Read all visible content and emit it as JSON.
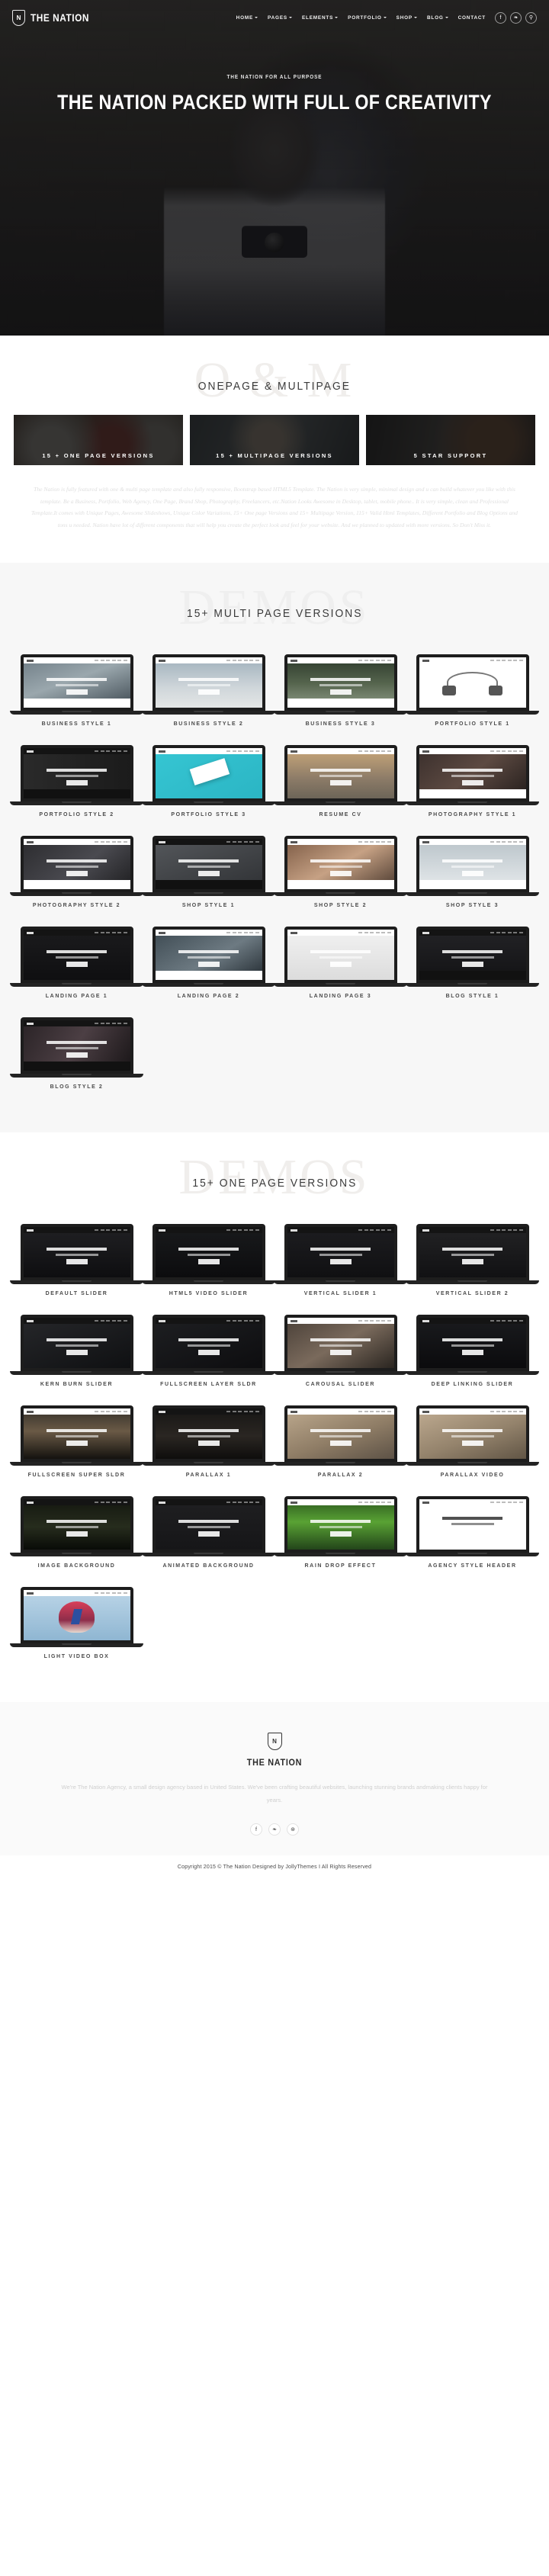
{
  "header": {
    "logo_initial": "N",
    "brand": "THE NATION",
    "nav": [
      {
        "label": "HOME",
        "caret": true
      },
      {
        "label": "PAGES",
        "caret": true
      },
      {
        "label": "ELEMENTS",
        "caret": true
      },
      {
        "label": "PORTFOLIO",
        "caret": true
      },
      {
        "label": "SHOP",
        "caret": true
      },
      {
        "label": "BLOG",
        "caret": true
      },
      {
        "label": "CONTACT",
        "caret": false
      }
    ],
    "social": [
      {
        "name": "facebook-icon",
        "glyph": "f"
      },
      {
        "name": "twitter-icon",
        "glyph": "❧"
      },
      {
        "name": "search-icon",
        "glyph": "⚲"
      }
    ]
  },
  "hero": {
    "subtitle": "THE NATION FOR ALL PURPOSE",
    "title": "THE NATION PACKED WITH FULL OF CREATIVITY"
  },
  "onepage_multipage": {
    "watermark": "O & M",
    "title": "ONEPAGE & MULTIPAGE",
    "boxes": [
      {
        "label": "15 + ONE PAGE VERSIONS"
      },
      {
        "label": "15 + MULTIPAGE VERSIONS"
      },
      {
        "label": "5 STAR SUPPORT"
      }
    ],
    "lead": "The Nation is fully featured with one & multi page template and also fully responsive, Bootstrap based HTML5 Template. The Nation is very simple, minimal design and u can build whatever you like with this template. Be a Business, Portfolio,  Web Agency, One Page, Brand Shop, Photography, Freelancers, etc.Nation Looks Awesome in Desktop, tablet, mobile phone.. It is very simple, clean and Professional Template.It comes with Unique Pages, Awesome Slideshows, Unique Color Variations, 15+ One page Versions and 15+ Multipage Version, 115+ Valid Html Templates, Different Portfolio and Blog Options and tons u needed. Nation have lot of different components that will help you create the perfect look and feel for your website. And we planned to updated with more versions. So Don't Miss it."
  },
  "multipage": {
    "watermark": "DEMOS",
    "title": "15+ MULTI PAGE VERSIONS",
    "items": [
      {
        "label": "BUSINESS STYLE 1",
        "style": "biz1"
      },
      {
        "label": "BUSINESS STYLE 2",
        "style": "biz2"
      },
      {
        "label": "BUSINESS STYLE 3",
        "style": "biz3"
      },
      {
        "label": "PORTFOLIO STYLE 1",
        "style": "port1"
      },
      {
        "label": "PORTFOLIO STYLE 2",
        "style": "port2"
      },
      {
        "label": "PORTFOLIO STYLE 3",
        "style": "port3"
      },
      {
        "label": "RESUME CV",
        "style": "resume"
      },
      {
        "label": "PHOTOGRAPHY STYLE 1",
        "style": "photo1"
      },
      {
        "label": "PHOTOGRAPHY STYLE 2",
        "style": "photo2"
      },
      {
        "label": "SHOP STYLE 1",
        "style": "shop1"
      },
      {
        "label": "SHOP STYLE 2",
        "style": "shop2"
      },
      {
        "label": "SHOP STYLE 3",
        "style": "shop3"
      },
      {
        "label": "LANDING PAGE 1",
        "style": "land1"
      },
      {
        "label": "LANDING PAGE 2",
        "style": "land2"
      },
      {
        "label": "LANDING PAGE 3",
        "style": "land3"
      },
      {
        "label": "BLOG STYLE 1",
        "style": "blog1"
      },
      {
        "label": "BLOG STYLE 2",
        "style": "blog2"
      }
    ]
  },
  "onepage": {
    "watermark": "DEMOS",
    "title": "15+ ONE PAGE VERSIONS",
    "items": [
      {
        "label": "DEFAULT SLIDER",
        "style": "dark"
      },
      {
        "label": "HTML5 VIDEO SLIDER",
        "style": "dark2"
      },
      {
        "label": "VERTICAL SLIDER 1",
        "style": "dark3"
      },
      {
        "label": "VERTICAL SLIDER 2",
        "style": "dark4"
      },
      {
        "label": "KERN BURN SLIDER",
        "style": "dark5"
      },
      {
        "label": "FULLSCREEN LAYER SLDR",
        "style": "dark6"
      },
      {
        "label": "CAROUSAL SLIDER",
        "style": "photo"
      },
      {
        "label": "DEEP LINKING SLIDER",
        "style": "dark7"
      },
      {
        "label": "FULLSCREEN SUPER SLDR",
        "style": "city"
      },
      {
        "label": "PARALLAX 1",
        "style": "nationdark"
      },
      {
        "label": "PARALLAX 2",
        "style": "room"
      },
      {
        "label": "PARALLAX VIDEO",
        "style": "room2"
      },
      {
        "label": "IMAGE BACKGROUND",
        "style": "forest"
      },
      {
        "label": "ANIMATED BACKGROUND",
        "style": "plain"
      },
      {
        "label": "RAIN DROP EFFECT",
        "style": "green"
      },
      {
        "label": "AGENCY STYLE HEADER",
        "style": "white"
      },
      {
        "label": "LIGHT VIDEO BOX",
        "style": "bowie"
      }
    ]
  },
  "footer": {
    "logo_initial": "N",
    "brand": "THE NATION",
    "text": "We're The Nation Agency, a small design agency based in United States. We've been crafting beautiful websites, launching stunning brands andmaking clients happy for years.",
    "social": [
      {
        "name": "facebook-icon",
        "glyph": "f"
      },
      {
        "name": "twitter-icon",
        "glyph": "❧"
      },
      {
        "name": "dribbble-icon",
        "glyph": "⊛"
      }
    ],
    "copyright": "Copyright 2015 © The Nation Designed by JollyThemes I All Rights Reserved"
  }
}
